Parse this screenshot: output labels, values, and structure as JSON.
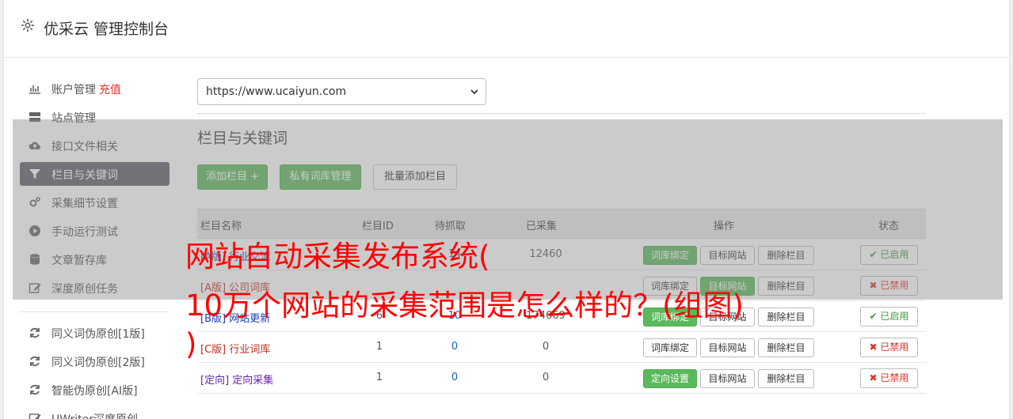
{
  "header": {
    "title": "优采云 管理控制台"
  },
  "sidebar": {
    "items": [
      {
        "label": "账户管理",
        "extra": "充值"
      },
      {
        "label": "站点管理"
      },
      {
        "label": "接口文件相关"
      },
      {
        "label": "栏目与关键词"
      },
      {
        "label": "采集细节设置"
      },
      {
        "label": "手动运行测试"
      },
      {
        "label": "文章暂存库"
      },
      {
        "label": "深度原创任务"
      },
      {
        "label": "同义词伪原创[1版]"
      },
      {
        "label": "同义词伪原创[2版]"
      },
      {
        "label": "智能伪原创[AI版]"
      },
      {
        "label": "UWriter深度原创"
      }
    ]
  },
  "site_select": {
    "value": "https://www.ucaiyun.com"
  },
  "section": {
    "title": "栏目与关键词",
    "add_column": "添加栏目 +",
    "private_lib": "私有词库管理",
    "batch_add": "批量添加栏目"
  },
  "table": {
    "headers": {
      "name": "栏目名称",
      "id": "栏目ID",
      "pending": "待抓取",
      "collected": "已采集",
      "ops": "操作",
      "status": "状态"
    },
    "rows": [
      {
        "name": "[A版] 行业交流",
        "id": "",
        "pending": "14",
        "collected": "12460",
        "op1": "词库绑定",
        "op2": "目标网站",
        "op3": "删除栏目",
        "status": "已启用"
      },
      {
        "name": "[A版] 公司词库",
        "id": "",
        "pending": "",
        "collected": "",
        "op1": "词库绑定",
        "op2": "目标网站",
        "op3": "删除栏目",
        "status": "已禁用"
      },
      {
        "name": "[B版] 网站更新",
        "id": "6",
        "pending": "10",
        "collected": "174669",
        "op1": "词库绑定",
        "op2": "目标网站",
        "op3": "删除栏目",
        "status": "已启用"
      },
      {
        "name": "[C版] 行业词库",
        "id": "1",
        "pending": "0",
        "collected": "0",
        "op1": "词库绑定",
        "op2": "目标网站",
        "op3": "删除栏目",
        "status": "已禁用"
      },
      {
        "name": "[定向] 定向采集",
        "id": "1",
        "pending": "0",
        "collected": "0",
        "op1": "定向设置",
        "op2": "目标网站",
        "op3": "删除栏目",
        "status": "已禁用"
      }
    ]
  },
  "headline": {
    "line1": "网站自动采集发布系统(",
    "line2": "10万个网站的采集范围是怎么样的？(组图)",
    "line3": ")"
  },
  "colors": {
    "accent_green": "#5cb85c",
    "active_nav": "#5b5f68",
    "headline_red": "#ff0000"
  }
}
